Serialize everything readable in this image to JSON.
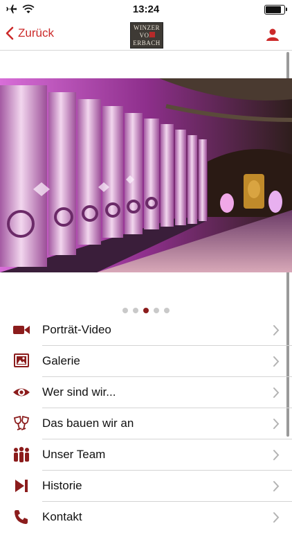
{
  "status_bar": {
    "time": "13:24"
  },
  "nav": {
    "back_label": "Zurück",
    "logo": {
      "line1": "WINZER",
      "line2": "VON",
      "line3": "ERBACH"
    }
  },
  "carousel": {
    "page_count": 5,
    "active_index": 2
  },
  "menu": [
    {
      "label": "Porträt-Video",
      "icon": "video-camera-icon"
    },
    {
      "label": "Galerie",
      "icon": "photo-gallery-icon"
    },
    {
      "label": "Wer sind wir...",
      "icon": "eye-icon"
    },
    {
      "label": "Das bauen wir an",
      "icon": "wine-glasses-icon"
    },
    {
      "label": "Unser Team",
      "icon": "team-people-icon"
    },
    {
      "label": "Historie",
      "icon": "skip-forward-icon"
    },
    {
      "label": "Kontakt",
      "icon": "phone-icon"
    }
  ],
  "colors": {
    "accent": "#cc2a2a",
    "icon_dark_red": "#8b1c1c"
  }
}
